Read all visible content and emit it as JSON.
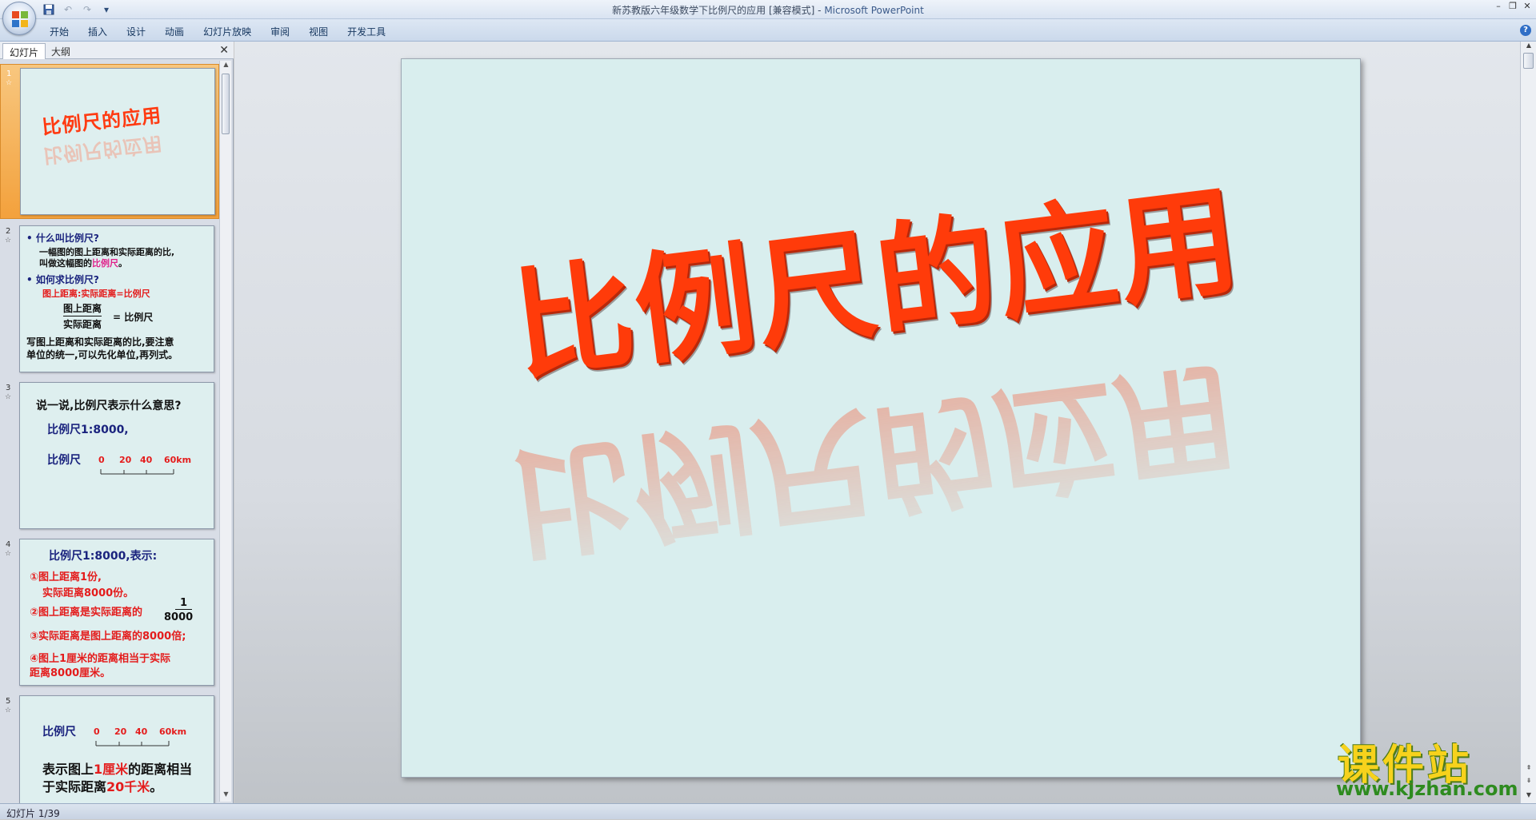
{
  "window": {
    "title_doc": "新苏教版六年级数学下比例尺的应用 [兼容模式] - ",
    "title_app": "Microsoft PowerPoint"
  },
  "ribbon": {
    "tabs": [
      "开始",
      "插入",
      "设计",
      "动画",
      "幻灯片放映",
      "审阅",
      "视图",
      "开发工具"
    ]
  },
  "left_pane": {
    "tab_slides": "幻灯片",
    "tab_outline": "大纲"
  },
  "slides": {
    "s1": {
      "num": "1",
      "title": "比例尺的应用"
    },
    "s2": {
      "num": "2",
      "l1": "• 什么叫比例尺?",
      "l2": "一幅图的图上距离和实际距离的比,",
      "l3a": "叫做这幅图的",
      "l3b": "比例尺",
      "l3c": "。",
      "l4": "• 如何求比例尺?",
      "l5": "图上距离:实际距离=比例尺",
      "frac_num": "图上距离",
      "frac_den": "实际距离",
      "frac_eq": "= 比例尺",
      "l6": "写图上距离和实际距离的比,要注意",
      "l7": "单位的统一,可以先化单位,再列式。"
    },
    "s3": {
      "num": "3",
      "l1": "说一说,比例尺表示什么意思?",
      "l2": "比例尺1:8000,",
      "label": "比例尺",
      "ticks": [
        "0",
        "20",
        "40",
        "60km"
      ]
    },
    "s4": {
      "num": "4",
      "l1": "比例尺1:8000,表示:",
      "l2": "①图上距离1份,",
      "l3": "实际距离8000份。",
      "l4": "②图上距离是实际距离的",
      "frac_num": "1",
      "frac_den": "8000",
      "l5": "③实际距离是图上距离的8000倍;",
      "l6": "④图上1厘米的距离相当于实际",
      "l7": "距离8000厘米。"
    },
    "s5": {
      "num": "5",
      "label": "比例尺",
      "ticks": [
        "0",
        "20",
        "40",
        "60km"
      ],
      "l1a": "表示图上",
      "l1b": "1厘米",
      "l1c": "的距离相当",
      "l2a": "于实际距离",
      "l2b": "20千米",
      "l2c": "。"
    }
  },
  "main_slide": {
    "title": "比例尺的应用",
    "title_color": "#ff3b0a",
    "background": "#d9eeee"
  },
  "watermark": {
    "brand": "课件站",
    "url": "www.kjzhan.com"
  },
  "status": {
    "slide_position": "幻灯片 1/39"
  }
}
